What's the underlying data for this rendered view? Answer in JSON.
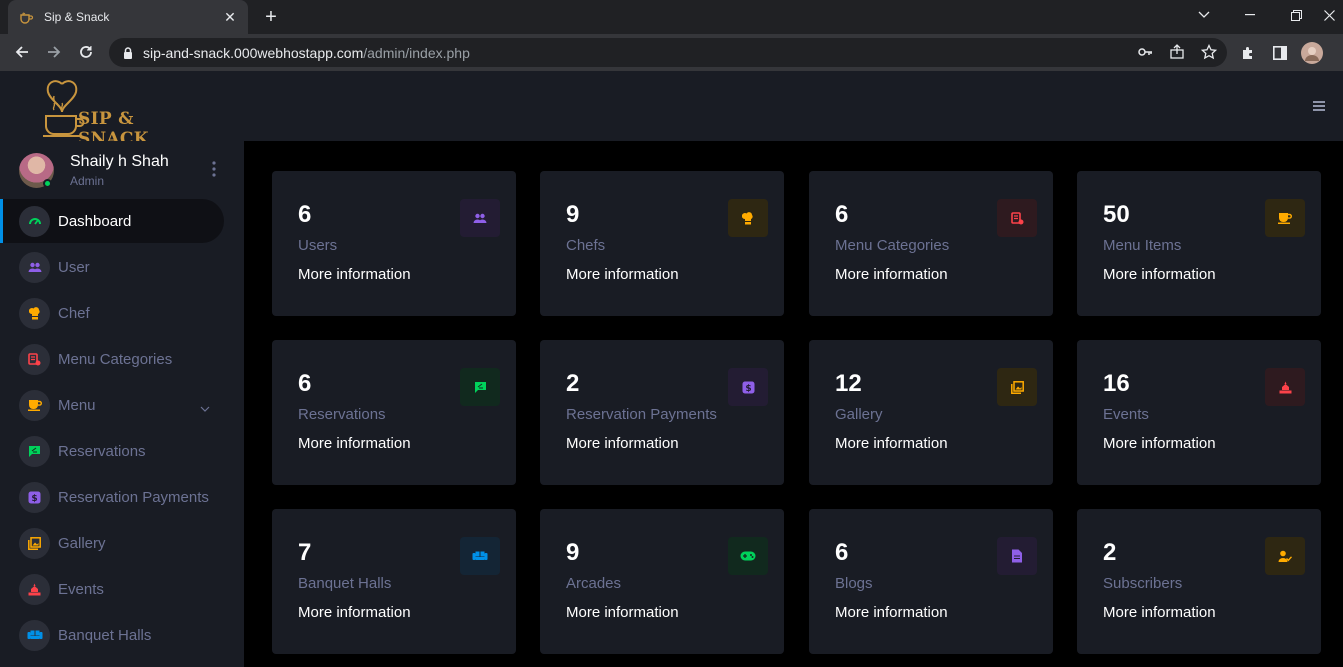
{
  "browser": {
    "tab_title": "Sip & Snack",
    "tab_close": "✕",
    "new_tab": "+",
    "url_host": "sip-and-snack.000webhostapp.com",
    "url_path": "/admin/index.php"
  },
  "app": {
    "logo_text": "SIP & SNACK"
  },
  "profile": {
    "name": "Shaily h Shah",
    "role": "Admin"
  },
  "sidebar": {
    "items": [
      {
        "label": "Dashboard",
        "icon": "speedometer-icon",
        "color": "#00d25b",
        "active": true
      },
      {
        "label": "User",
        "icon": "users-icon",
        "color": "#8f5fe8"
      },
      {
        "label": "Chef",
        "icon": "chef-hat-icon",
        "color": "#ffab00"
      },
      {
        "label": "Menu Categories",
        "icon": "menu-list-icon",
        "color": "#fc424a"
      },
      {
        "label": "Menu",
        "icon": "cup-icon",
        "color": "#ffab00",
        "has_caret": true
      },
      {
        "label": "Reservations",
        "icon": "message-icon",
        "color": "#00d25b"
      },
      {
        "label": "Reservation Payments",
        "icon": "dollar-icon",
        "color": "#8f5fe8"
      },
      {
        "label": "Gallery",
        "icon": "gallery-icon",
        "color": "#ffab00"
      },
      {
        "label": "Events",
        "icon": "event-cake-icon",
        "color": "#fc424a"
      },
      {
        "label": "Banquet Halls",
        "icon": "sofa-icon",
        "color": "#0090e7"
      }
    ]
  },
  "cards": [
    {
      "count": "6",
      "label": "Users",
      "more": "More information",
      "icon": "users-icon",
      "color": "#8f5fe8",
      "bg": "#231c33"
    },
    {
      "count": "9",
      "label": "Chefs",
      "more": "More information",
      "icon": "chef-hat-icon",
      "color": "#ffab00",
      "bg": "#2e2712"
    },
    {
      "count": "6",
      "label": "Menu Categories",
      "more": "More information",
      "icon": "menu-list-icon",
      "color": "#fc424a",
      "bg": "#2e1a1f"
    },
    {
      "count": "50",
      "label": "Menu Items",
      "more": "More information",
      "icon": "cup-icon",
      "color": "#ffab00",
      "bg": "#2e2712"
    },
    {
      "count": "6",
      "label": "Reservations",
      "more": "More information",
      "icon": "message-icon",
      "color": "#00d25b",
      "bg": "#11291e"
    },
    {
      "count": "2",
      "label": "Reservation Payments",
      "more": "More information",
      "icon": "dollar-icon",
      "color": "#8f5fe8",
      "bg": "#231c33"
    },
    {
      "count": "12",
      "label": "Gallery",
      "more": "More information",
      "icon": "gallery-icon",
      "color": "#ffab00",
      "bg": "#2e2712"
    },
    {
      "count": "16",
      "label": "Events",
      "more": "More information",
      "icon": "event-cake-icon",
      "color": "#fc424a",
      "bg": "#2e1a1f"
    },
    {
      "count": "7",
      "label": "Banquet Halls",
      "more": "More information",
      "icon": "sofa-icon",
      "color": "#0090e7",
      "bg": "#142535"
    },
    {
      "count": "9",
      "label": "Arcades",
      "more": "More information",
      "icon": "gamepad-icon",
      "color": "#00d25b",
      "bg": "#11291e"
    },
    {
      "count": "6",
      "label": "Blogs",
      "more": "More information",
      "icon": "document-icon",
      "color": "#8f5fe8",
      "bg": "#231c33"
    },
    {
      "count": "2",
      "label": "Subscribers",
      "more": "More information",
      "icon": "subscriber-icon",
      "color": "#ffab00",
      "bg": "#2e2712"
    }
  ]
}
